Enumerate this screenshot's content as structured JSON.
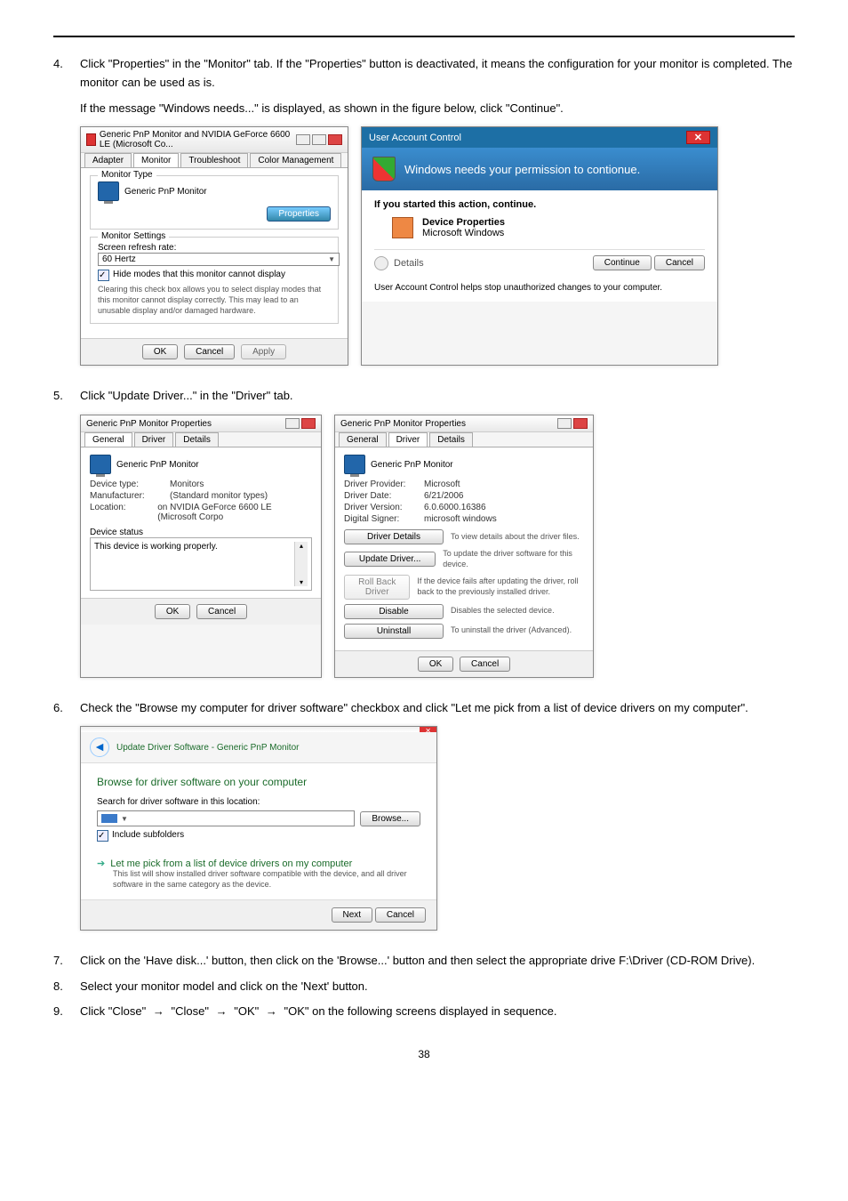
{
  "page_number": "38",
  "step4": {
    "num": "4.",
    "text": "Click \"Properties\" in the \"Monitor\" tab. If the \"Properties\" button is deactivated, it means the configuration for your monitor is completed. The monitor can be used as is.",
    "line2": "If the message \"Windows needs...\" is displayed, as shown in the figure below, click \"Continue\"."
  },
  "win1": {
    "title": "Generic PnP Monitor and NVIDIA GeForce 6600 LE (Microsoft Co...",
    "tabs": [
      "Adapter",
      "Monitor",
      "Troubleshoot",
      "Color Management"
    ],
    "monitor_type_label": "Monitor Type",
    "monitor_name": "Generic PnP Monitor",
    "properties_btn": "Properties",
    "settings_label": "Monitor Settings",
    "refresh_label": "Screen refresh rate:",
    "refresh_value": "60 Hertz",
    "hide_checkbox": "Hide modes that this monitor cannot display",
    "hide_desc": "Clearing this check box allows you to select display modes that this monitor cannot display correctly. This may lead to an unusable display and/or damaged hardware.",
    "ok": "OK",
    "cancel": "Cancel",
    "apply": "Apply"
  },
  "uac": {
    "title": "User Account Control",
    "headline": "Windows needs your permission to contionue.",
    "if_line": "If you started this action, continue.",
    "app_name": "Device Properties",
    "app_pub": "Microsoft Windows",
    "details": "Details",
    "continue": "Continue",
    "cancel": "Cancel",
    "footer": "User Account Control helps stop unauthorized changes to your computer."
  },
  "step5": {
    "num": "5.",
    "text": "Click \"Update Driver...\" in the \"Driver\" tab."
  },
  "props_general": {
    "title": "Generic PnP Monitor Properties",
    "tabs": [
      "General",
      "Driver",
      "Details"
    ],
    "name": "Generic PnP Monitor",
    "rows": [
      {
        "k": "Device type:",
        "v": "Monitors"
      },
      {
        "k": "Manufacturer:",
        "v": "(Standard monitor types)"
      },
      {
        "k": "Location:",
        "v": "on NVIDIA GeForce 6600 LE (Microsoft Corpo"
      }
    ],
    "status_label": "Device status",
    "status_text": "This device is working properly.",
    "ok": "OK",
    "cancel": "Cancel"
  },
  "props_driver": {
    "title": "Generic PnP Monitor Properties",
    "tabs": [
      "General",
      "Driver",
      "Details"
    ],
    "name": "Generic PnP Monitor",
    "rows": [
      {
        "k": "Driver Provider:",
        "v": "Microsoft"
      },
      {
        "k": "Driver Date:",
        "v": "6/21/2006"
      },
      {
        "k": "Driver Version:",
        "v": "6.0.6000.16386"
      },
      {
        "k": "Digital Signer:",
        "v": "microsoft windows"
      }
    ],
    "buttons": [
      {
        "b": "Driver Details",
        "d": "To view details about the driver files."
      },
      {
        "b": "Update Driver...",
        "d": "To update the driver software for this device."
      },
      {
        "b": "Roll Back Driver",
        "d": "If the device fails after updating the driver, roll back to the previously installed driver."
      },
      {
        "b": "Disable",
        "d": "Disables the selected device."
      },
      {
        "b": "Uninstall",
        "d": "To uninstall the driver (Advanced)."
      }
    ],
    "ok": "OK",
    "cancel": "Cancel"
  },
  "step6": {
    "num": "6.",
    "text": "Check the \"Browse my computer for driver software\" checkbox and click \"Let me pick from a list of device drivers on my computer\"."
  },
  "wizard": {
    "crumb": "Update Driver Software - Generic PnP Monitor",
    "heading": "Browse for driver software on your computer",
    "search_label": "Search for driver software in this location:",
    "browse": "Browse...",
    "include": "Include subfolders",
    "option_title": "Let me pick from a list of device drivers on my computer",
    "option_desc": "This list will show installed driver software compatible with the device, and all driver software in the same category as the device.",
    "next": "Next",
    "cancel": "Cancel"
  },
  "step7": {
    "num": "7.",
    "text": "Click on the 'Have disk...' button, then click on the 'Browse...' button and then select the appropriate drive F:\\Driver (CD-ROM Drive)."
  },
  "step8": {
    "num": "8.",
    "text": "Select your monitor model and click on the 'Next' button."
  },
  "step9": {
    "num": "9.",
    "prefix": "Click ",
    "seq": [
      "\"Close\"",
      "\"Close\"",
      "\"OK\"",
      "\"OK\""
    ],
    "suffix": " on the following screens displayed in sequence."
  }
}
